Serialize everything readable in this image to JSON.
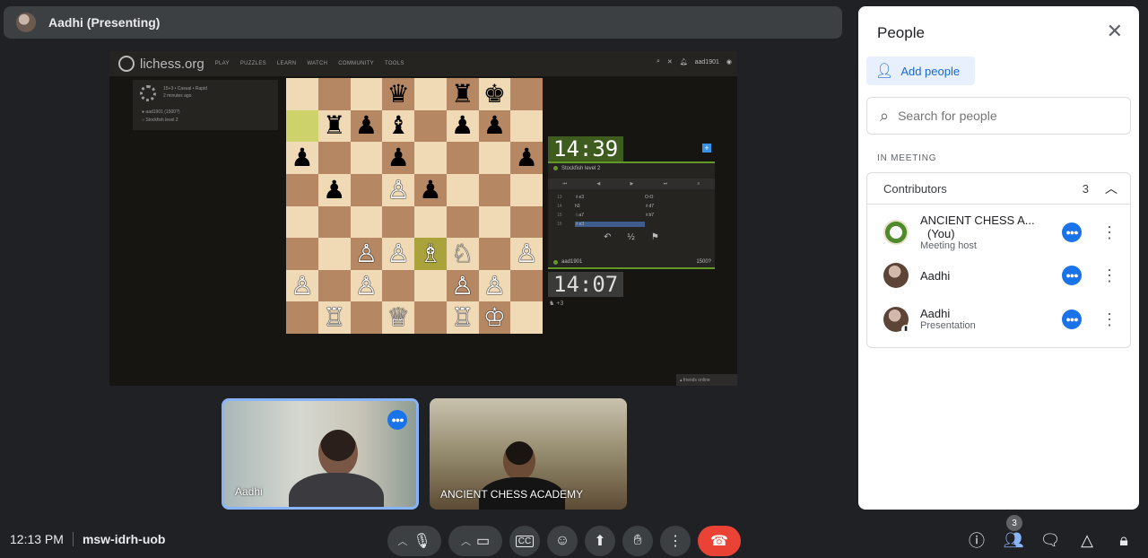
{
  "presenter": {
    "title": "Aadhi (Presenting)"
  },
  "lichess": {
    "logo": "lichess.org",
    "menu": [
      "PLAY",
      "PUZZLES",
      "LEARN",
      "WATCH",
      "COMMUNITY",
      "TOOLS"
    ],
    "username": "aad1901",
    "game_info": {
      "mode": "15+3 • Casual • Rapid",
      "ago": "2 minutes ago",
      "white": "aad1901 (1500?)",
      "black": "Stockfish level 2"
    },
    "clock_top": "14:39",
    "clock_bottom": "14:07",
    "opponent": "Stockfish level 2",
    "me": "aad1901",
    "me_elo": "1500?",
    "moves": [
      {
        "n": "13",
        "w": "♗e3",
        "b": "O-O"
      },
      {
        "n": "14",
        "w": "h3",
        "b": "♗d7"
      },
      {
        "n": "15",
        "w": "♘a7",
        "b": "♗b7"
      },
      {
        "n": "16",
        "w": "♗e3",
        "b": ""
      }
    ],
    "half": "½",
    "captured": "+3",
    "friends": "▴ friends online",
    "board": [
      [
        "l",
        "d",
        "l",
        "d",
        "l",
        "d",
        "l",
        "d"
      ],
      [
        "hld",
        "l",
        "d",
        "l",
        "d",
        "l",
        "d",
        "l"
      ],
      [
        "l",
        "d",
        "l",
        "d",
        "l",
        "d",
        "l",
        "d"
      ],
      [
        "d",
        "l",
        "d",
        "l",
        "d",
        "l",
        "d",
        "l"
      ],
      [
        "l",
        "d",
        "l",
        "d",
        "l",
        "d",
        "l",
        "d"
      ],
      [
        "d",
        "l",
        "d",
        "l",
        "hl",
        "l",
        "d",
        "l"
      ],
      [
        "l",
        "d",
        "l",
        "d",
        "l",
        "d",
        "l",
        "d"
      ],
      [
        "d",
        "l",
        "d",
        "l",
        "d",
        "l",
        "d",
        "l"
      ]
    ],
    "pieces": [
      [
        "",
        "",
        "",
        "♛",
        "",
        "♜",
        "♚",
        ""
      ],
      [
        "",
        "♜",
        "♟",
        "♝",
        "",
        "♟",
        "♟",
        ""
      ],
      [
        "♟",
        "",
        "",
        "♟",
        "",
        "",
        "",
        "♟"
      ],
      [
        "",
        "♟",
        "",
        "♙",
        "♟",
        "",
        "",
        ""
      ],
      [
        "",
        "",
        "",
        "",
        "",
        "",
        "",
        ""
      ],
      [
        "",
        "",
        "♙",
        "♙",
        "♗",
        "♘",
        "",
        "♙"
      ],
      [
        "♙",
        "",
        "♙",
        "",
        "",
        "♙",
        "♙",
        ""
      ],
      [
        "",
        "♖",
        "",
        "♕",
        "",
        "♖",
        "♔",
        ""
      ]
    ]
  },
  "tiles": [
    {
      "name": "Aadhi"
    },
    {
      "name": "ANCIENT CHESS ACADEMY"
    }
  ],
  "people_panel": {
    "title": "People",
    "add_people": "Add people",
    "search_placeholder": "Search for people",
    "section": "IN MEETING",
    "group": "Contributors",
    "group_count": "3",
    "participants": [
      {
        "name": "ANCIENT CHESS A...",
        "tag": "(You)",
        "sub": "Meeting host"
      },
      {
        "name": "Aadhi",
        "tag": "",
        "sub": ""
      },
      {
        "name": "Aadhi",
        "tag": "",
        "sub": "Presentation"
      }
    ]
  },
  "bottom": {
    "time": "12:13 PM",
    "meeting_code": "msw-idrh-uob",
    "people_count": "3"
  },
  "colors": {
    "accent": "#1a73e8",
    "end_call": "#ea4335",
    "panel_bg": "#ffffff",
    "app_bg": "#202124"
  }
}
